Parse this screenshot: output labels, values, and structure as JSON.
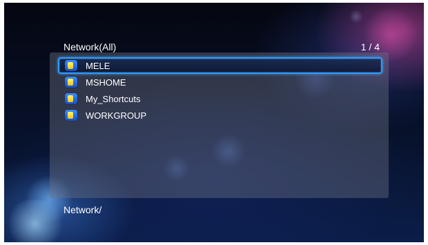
{
  "header": {
    "title": "Network(All)",
    "page_counter": "1 / 4"
  },
  "list": {
    "selected_index": 0,
    "items": [
      {
        "label": "MELE",
        "icon": "network-folder-icon"
      },
      {
        "label": "MSHOME",
        "icon": "network-folder-icon"
      },
      {
        "label": "My_Shortcuts",
        "icon": "network-folder-icon"
      },
      {
        "label": "WORKGROUP",
        "icon": "network-folder-icon"
      }
    ]
  },
  "footer": {
    "path": "Network/"
  },
  "colors": {
    "selection_border": "#2f9bff",
    "icon_folder_blue": "#1f6be0",
    "icon_folder_yellow": "#f6c21c",
    "text": "#ffffff"
  }
}
